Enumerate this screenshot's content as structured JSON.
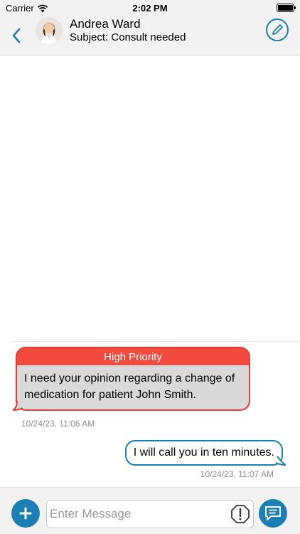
{
  "status_bar": {
    "carrier": "Carrier",
    "time": "2:02 PM",
    "icons": [
      "wifi-icon",
      "battery-icon"
    ]
  },
  "header": {
    "contact_name": "Andrea Ward",
    "subject": "Subject: Consult needed",
    "icons": [
      "back-chevron-icon",
      "avatar",
      "compose-pencil-icon"
    ]
  },
  "messages": [
    {
      "direction": "incoming",
      "priority_label": "High Priority",
      "text": "I need your opinion regarding a change of medication for patient John Smith.",
      "timestamp": "10/24/23, 11:06 AM"
    },
    {
      "direction": "outgoing",
      "text": "I will call you in ten minutes.",
      "timestamp": "10/24/23, 11:07 AM"
    }
  ],
  "composer": {
    "placeholder": "Enter Message",
    "icons": [
      "plus-icon",
      "priority-exclamation-icon",
      "send-message-icon"
    ]
  },
  "colors": {
    "accent": "#1a7fb4",
    "priority_red": "#f24a3d",
    "bubble_gray": "#d9d9d9",
    "bar_gray": "#f2f2f2"
  }
}
